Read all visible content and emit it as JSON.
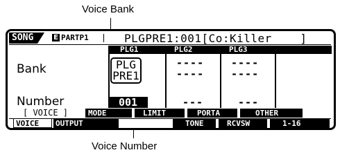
{
  "callouts": {
    "top": "Voice Bank",
    "bottom": "Voice Number"
  },
  "header": {
    "mode": "SONG",
    "part_icon": "E",
    "part": "PARTP1",
    "voice_name": "PLGPRE1:001[Co:Killer    ]"
  },
  "columns": [
    "PLG1",
    "PLG2",
    "PLG3"
  ],
  "rows": {
    "bank_label": "Bank",
    "number_label": "Number"
  },
  "values": {
    "bank_line1": "PLG",
    "bank_line2": "PRE1",
    "bank_plg2_line1": "----",
    "bank_plg2_line2": "----",
    "bank_plg3_line1": "----",
    "bank_plg3_line2": "----",
    "number_plg1": "001",
    "number_plg2": "---",
    "number_plg3": "---"
  },
  "function_row": {
    "current": "[ VOICE ]",
    "buttons": [
      "MODE",
      "LIMIT",
      "PORTA",
      "OTHER"
    ]
  },
  "tabs": {
    "left": [
      "VOICE",
      "OUTPUT"
    ],
    "right": [
      "TONE",
      "RCVSW",
      "1-16"
    ]
  }
}
